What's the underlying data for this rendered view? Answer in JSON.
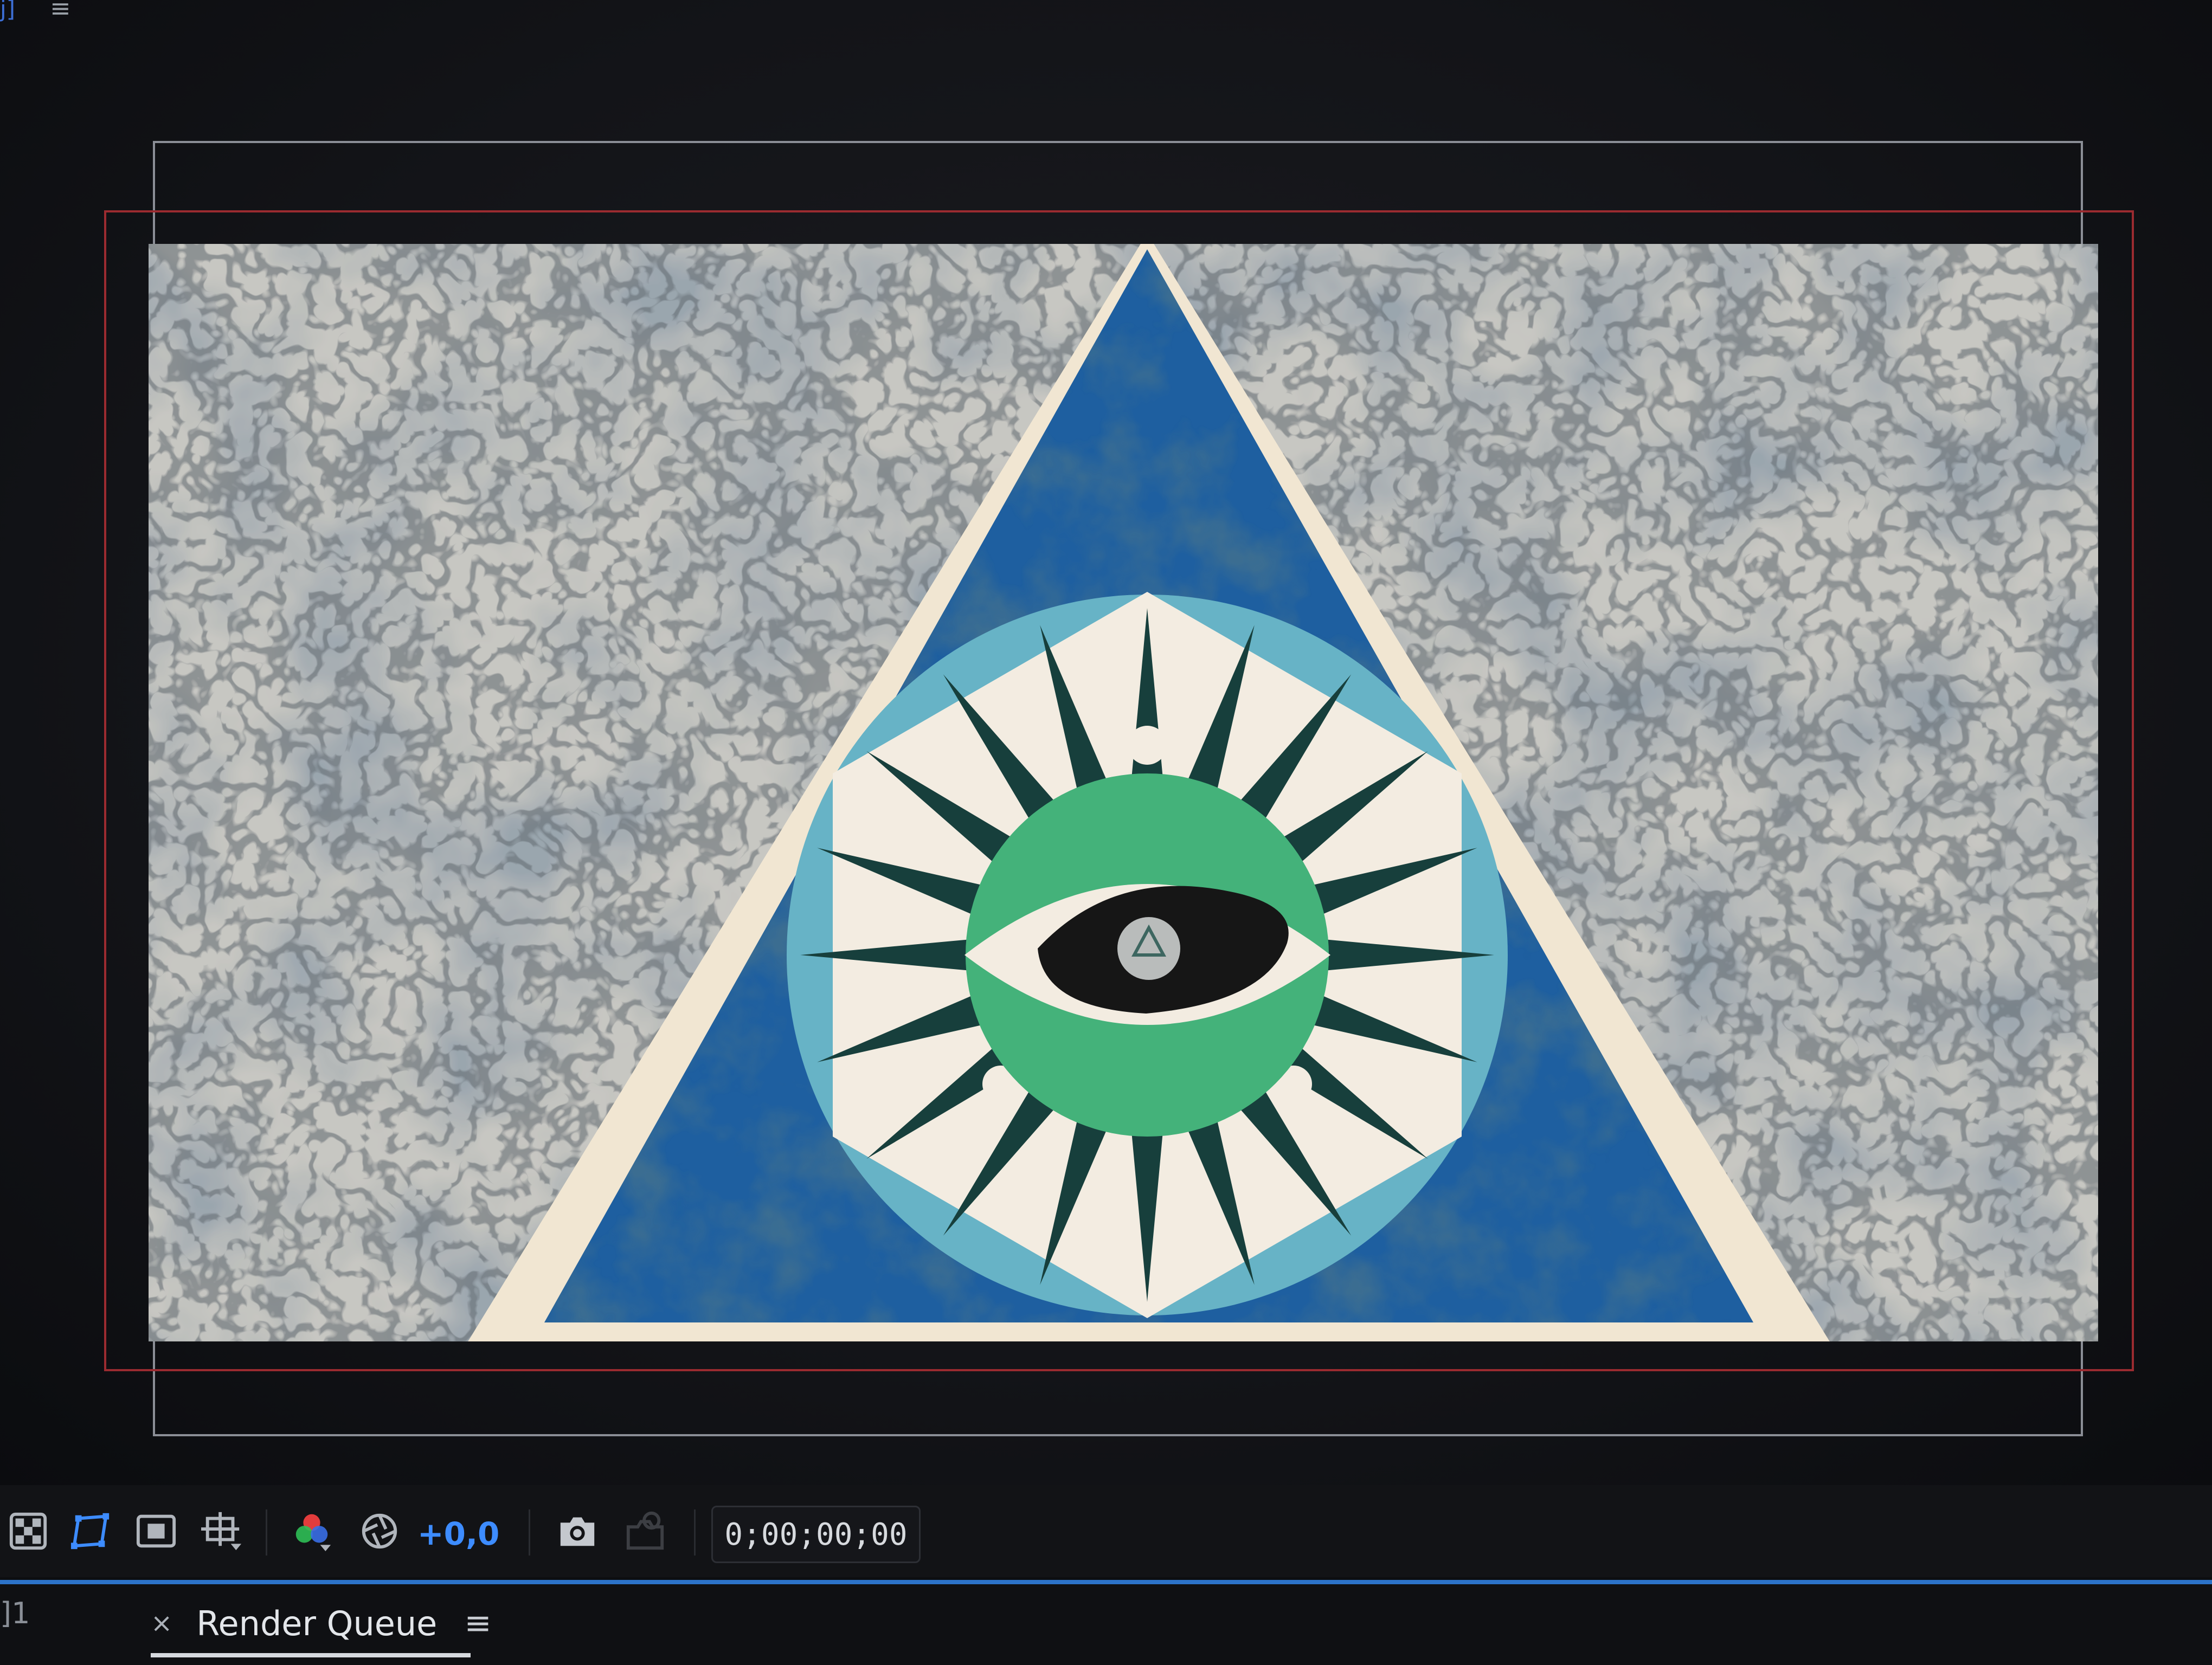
{
  "panel": {
    "left_label": "j]",
    "menu_icon": "hamburger-menu-icon"
  },
  "composition": {
    "background": "cracked-concrete-texture",
    "artwork": "all-seeing-eye-triangle",
    "colors": {
      "triangle_border": "#f1e6d2",
      "triangle_fill": "#1e5fa0",
      "circle": "#67b3c6",
      "hexagon": "#f3ece1",
      "spikes": "#173f3c",
      "iris": "#44b27a",
      "eye": "#161616"
    }
  },
  "toolbar": {
    "buttons": [
      {
        "name": "transparency-grid-icon"
      },
      {
        "name": "mask-path-visibility-icon"
      },
      {
        "name": "region-of-interest-icon"
      },
      {
        "name": "guide-options-icon"
      },
      {
        "name": "color-channels-icon"
      },
      {
        "name": "exposure-reset-icon"
      }
    ],
    "exposure_value": "+0,0",
    "snapshot_icon": "camera-icon",
    "show_snapshot_icon": "show-snapshot-icon",
    "timecode": "0;00;00;00"
  },
  "bottom_panel": {
    "left_label": "]1",
    "tab": {
      "close": "×",
      "title": "Render Queue",
      "menu": "≡"
    }
  }
}
